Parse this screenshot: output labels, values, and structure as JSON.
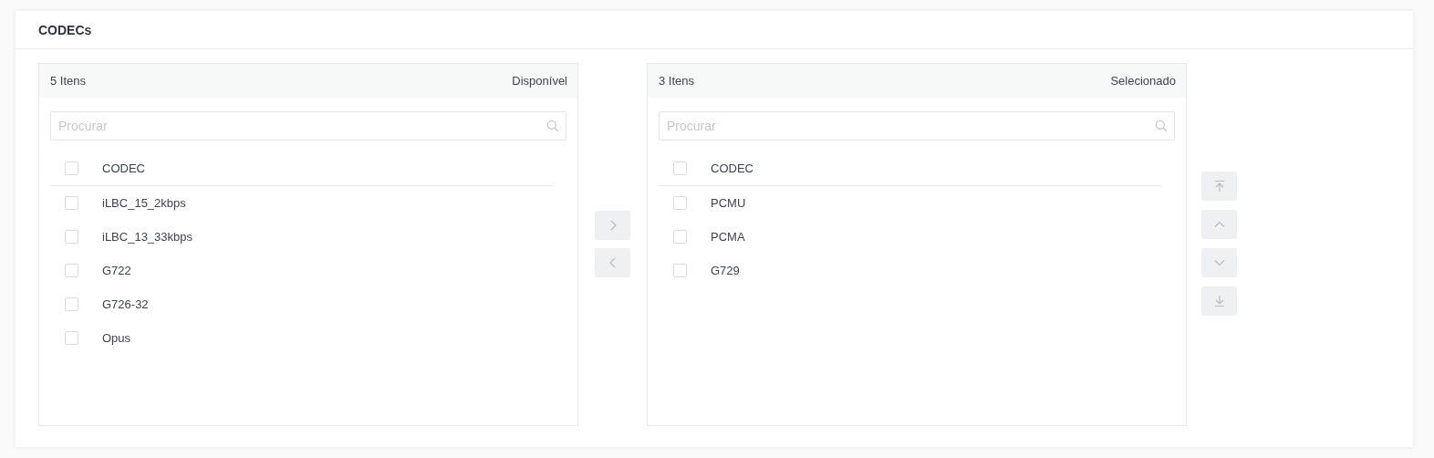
{
  "card": {
    "title": "CODECs"
  },
  "panels": [
    {
      "count": "5 Itens",
      "caption": "Disponível",
      "search": {
        "placeholder": "Procurar"
      },
      "header": {
        "label": "CODEC",
        "checked": false
      },
      "items": [
        {
          "label": "iLBC_15_2kbps",
          "checked": false
        },
        {
          "label": "iLBC_13_33kbps",
          "checked": false
        },
        {
          "label": "G722",
          "checked": false
        },
        {
          "label": "G726-32",
          "checked": false
        },
        {
          "label": "Opus",
          "checked": false
        }
      ]
    },
    {
      "count": "3 Itens",
      "caption": "Selecionado",
      "search": {
        "placeholder": "Procurar"
      },
      "header": {
        "label": "CODEC",
        "checked": false
      },
      "items": [
        {
          "label": "PCMU",
          "checked": false
        },
        {
          "label": "PCMA",
          "checked": false
        },
        {
          "label": "G729",
          "checked": false
        }
      ]
    }
  ],
  "transfer_buttons": [
    {
      "kind": "right",
      "disabled": true
    },
    {
      "kind": "left",
      "disabled": true
    }
  ],
  "order_buttons": [
    {
      "kind": "top",
      "disabled": true
    },
    {
      "kind": "up",
      "disabled": true
    },
    {
      "kind": "down",
      "disabled": true
    },
    {
      "kind": "bottom",
      "disabled": true
    }
  ]
}
